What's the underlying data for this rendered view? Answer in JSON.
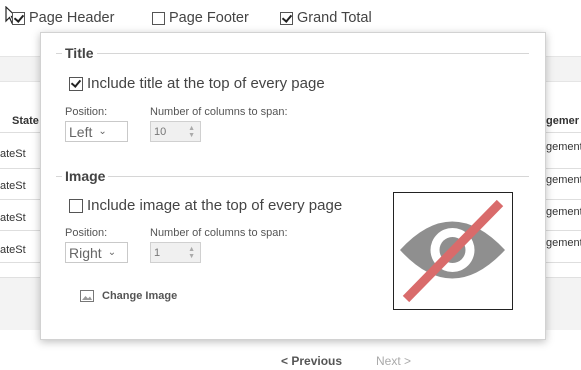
{
  "topbar": {
    "options": [
      {
        "label": "Page Header",
        "checked": true
      },
      {
        "label": "Page Footer",
        "checked": false
      },
      {
        "label": "Grand Total",
        "checked": true
      }
    ]
  },
  "background_table": {
    "headers": [
      "State",
      "gemer"
    ],
    "rows": [
      [
        "ateSt",
        "gement"
      ],
      [
        "ateSt",
        "gement"
      ],
      [
        "ateSt",
        "gement"
      ],
      [
        "ateSt",
        "gement"
      ]
    ]
  },
  "pager": {
    "previous": "< Previous",
    "next": "Next >"
  },
  "panel": {
    "title_section": {
      "legend": "Title",
      "include_label": "Include title at the top of every page",
      "include_checked": true,
      "position_label": "Position:",
      "position_value": "Left",
      "columns_label": "Number of columns to span:",
      "columns_value": "10"
    },
    "image_section": {
      "legend": "Image",
      "include_label": "Include image at the top of every page",
      "include_checked": false,
      "position_label": "Position:",
      "position_value": "Right",
      "columns_label": "Number of columns to span:",
      "columns_value": "1",
      "change_image_label": "Change Image",
      "preview_icon": "eye-slash-icon"
    }
  },
  "colors": {
    "eye": "#8f8f8f",
    "slash": "#d96b6b"
  }
}
